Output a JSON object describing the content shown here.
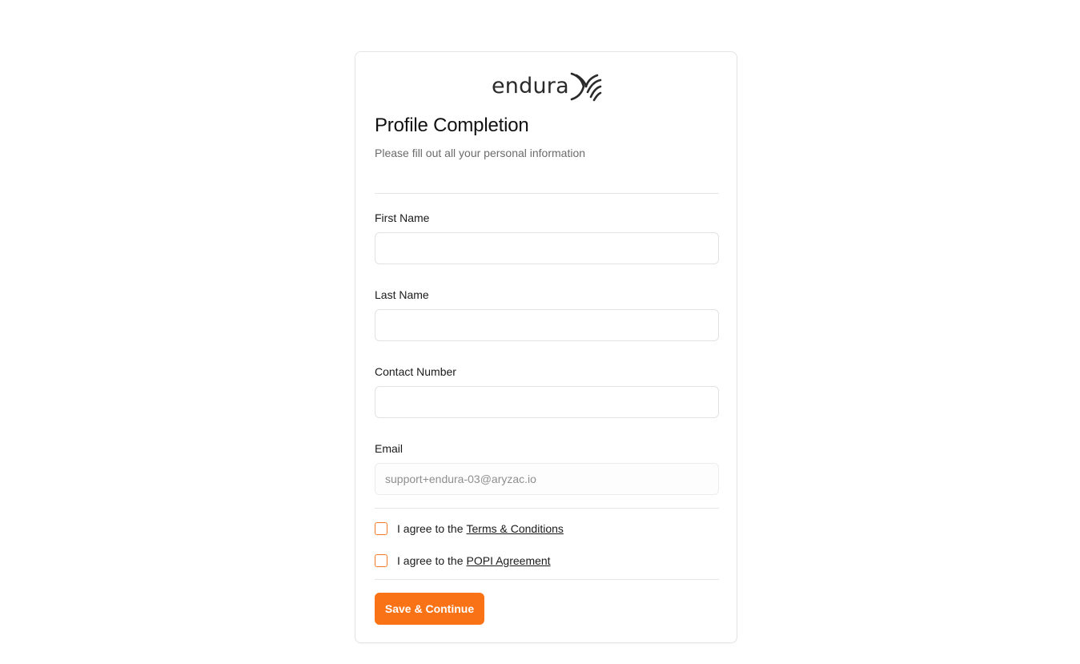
{
  "brand": {
    "name": "endura",
    "logo_icon": "endura-wave-logo-icon"
  },
  "form": {
    "title": "Profile Completion",
    "subtitle": "Please fill out all your personal information",
    "fields": [
      {
        "label": "First Name",
        "value": "",
        "placeholder": ""
      },
      {
        "label": "Last Name",
        "value": "",
        "placeholder": ""
      },
      {
        "label": "Contact Number",
        "value": "",
        "placeholder": ""
      },
      {
        "label": "Email",
        "value": "support+endura-03@aryzac.io",
        "placeholder": "",
        "disabled": true
      }
    ],
    "agreements": [
      {
        "prefix": "I agree to the",
        "link": "Terms & Conditions",
        "checked": false
      },
      {
        "prefix": "I agree to the",
        "link": "POPI Agreement",
        "checked": false
      }
    ],
    "submit_label": "Save & Continue"
  },
  "colors": {
    "accent": "#f97316",
    "checkbox_border": "#f07b2a",
    "border": "#e2e2e2"
  }
}
